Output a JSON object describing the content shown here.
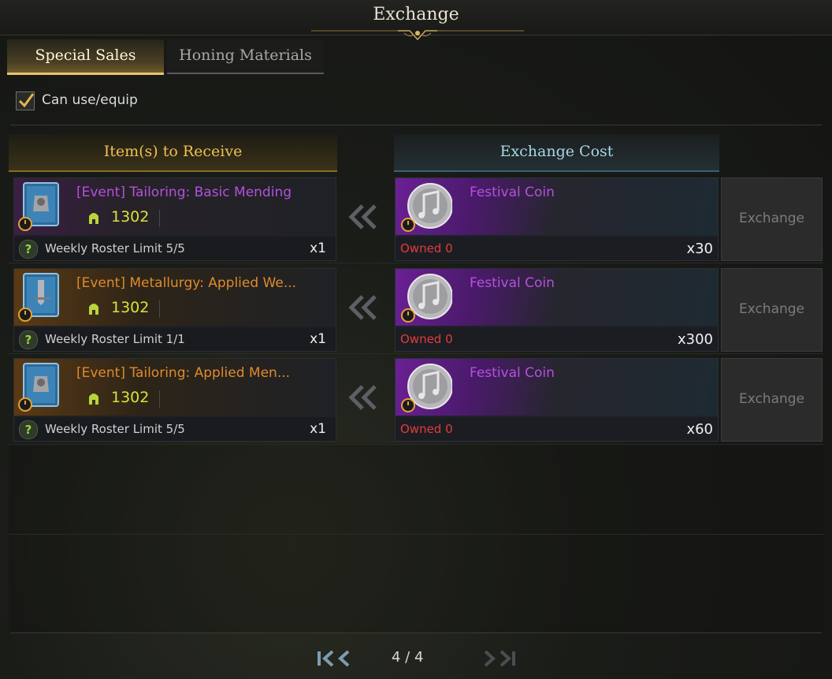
{
  "window": {
    "title": "Exchange"
  },
  "tabs": [
    {
      "label": "Special Sales",
      "active": true
    },
    {
      "label": "Honing Materials",
      "active": false
    }
  ],
  "filter": {
    "label": "Can use/equip",
    "checked": true
  },
  "columns": {
    "receive": "Item(s) to Receive",
    "cost": "Exchange Cost"
  },
  "rows": [
    {
      "item_name": "[Event] Tailoring: Basic Mending",
      "item_name_color": "#b451dd",
      "item_icon": "blue-book-icon",
      "level": "1302",
      "limit": "Weekly Roster Limit 5/5",
      "qty": "x1",
      "cost_name": "Festival Coin",
      "cost_icon": "festival-coin-icon",
      "owned": "Owned 0",
      "cost_qty": "x30",
      "button": "Exchange"
    },
    {
      "item_name": "[Event] Metallurgy: Applied We...",
      "item_name_color": "#e08a2c",
      "item_icon": "blue-book-sword-icon",
      "level": "1302",
      "limit": "Weekly Roster Limit 1/1",
      "qty": "x1",
      "cost_name": "Festival Coin",
      "cost_icon": "festival-coin-icon",
      "owned": "Owned 0",
      "cost_qty": "x300",
      "button": "Exchange"
    },
    {
      "item_name": "[Event] Tailoring: Applied Men...",
      "item_name_color": "#e08a2c",
      "item_icon": "blue-book-icon",
      "level": "1302",
      "limit": "Weekly Roster Limit 5/5",
      "qty": "x1",
      "cost_name": "Festival Coin",
      "cost_icon": "festival-coin-icon",
      "owned": "Owned 0",
      "cost_qty": "x60",
      "button": "Exchange"
    }
  ],
  "pagination": {
    "text": "4 / 4"
  }
}
